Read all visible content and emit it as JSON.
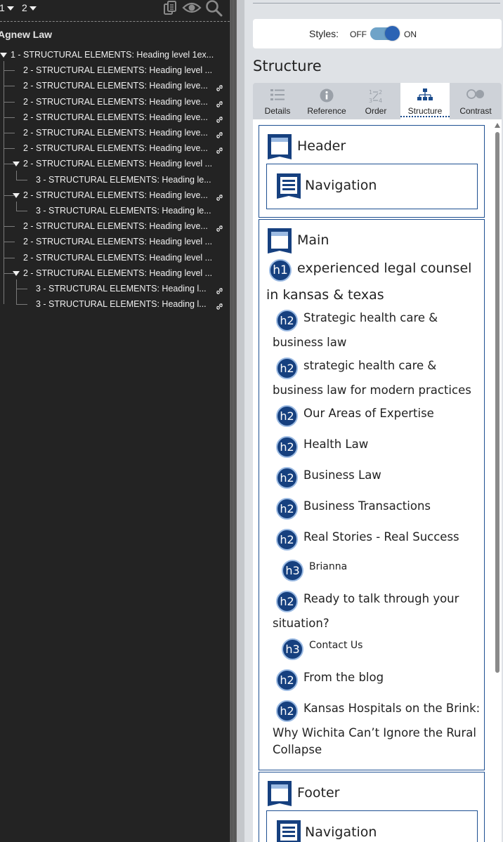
{
  "toolbar": {
    "level_from": "1",
    "level_to": "2"
  },
  "document": {
    "title": "Agnew Law"
  },
  "outline": [
    {
      "text": "1 - STRUCTURAL ELEMENTS: Heading level 1ex...",
      "level": 1,
      "has_link": false,
      "expanded": true
    },
    {
      "text": "2 - STRUCTURAL ELEMENTS: Heading level ...",
      "level": 2,
      "has_link": false
    },
    {
      "text": "2 - STRUCTURAL ELEMENTS: Heading leve...",
      "level": 2,
      "has_link": true
    },
    {
      "text": "2 - STRUCTURAL ELEMENTS: Heading leve...",
      "level": 2,
      "has_link": true
    },
    {
      "text": "2 - STRUCTURAL ELEMENTS: Heading leve...",
      "level": 2,
      "has_link": true
    },
    {
      "text": "2 - STRUCTURAL ELEMENTS: Heading leve...",
      "level": 2,
      "has_link": true
    },
    {
      "text": "2 - STRUCTURAL ELEMENTS: Heading leve...",
      "level": 2,
      "has_link": true
    },
    {
      "text": "2 - STRUCTURAL ELEMENTS: Heading level ...",
      "level": 2,
      "has_link": false,
      "expanded": true
    },
    {
      "text": "3 - STRUCTURAL ELEMENTS: Heading le...",
      "level": 3,
      "has_link": false
    },
    {
      "text": "2 - STRUCTURAL ELEMENTS: Heading leve...",
      "level": 2,
      "has_link": true,
      "expanded": true
    },
    {
      "text": "3 - STRUCTURAL ELEMENTS: Heading le...",
      "level": 3,
      "has_link": false
    },
    {
      "text": "2 - STRUCTURAL ELEMENTS: Heading leve...",
      "level": 2,
      "has_link": true
    },
    {
      "text": "2 - STRUCTURAL ELEMENTS: Heading level ...",
      "level": 2,
      "has_link": false
    },
    {
      "text": "2 - STRUCTURAL ELEMENTS: Heading level ...",
      "level": 2,
      "has_link": false
    },
    {
      "text": "2 - STRUCTURAL ELEMENTS: Heading level ...",
      "level": 2,
      "has_link": false,
      "expanded": true
    },
    {
      "text": "3 - STRUCTURAL ELEMENTS: Heading l...",
      "level": 3,
      "has_link": true
    },
    {
      "text": "3 - STRUCTURAL ELEMENTS: Heading l...",
      "level": 3,
      "has_link": true
    }
  ],
  "wave": {
    "styles_label": "Styles:",
    "styles_off": "OFF",
    "styles_on": "ON",
    "section_title": "Structure",
    "tabs": [
      {
        "label": "Details",
        "icon": "list-icon"
      },
      {
        "label": "Reference",
        "icon": "info-icon"
      },
      {
        "label": "Order",
        "icon": "order-icon"
      },
      {
        "label": "Structure",
        "icon": "structure-icon",
        "active": true
      },
      {
        "label": "Contrast",
        "icon": "contrast-icon"
      }
    ],
    "regions": {
      "header": "Header",
      "header_nav": "Navigation",
      "main": "Main",
      "footer": "Footer",
      "footer_nav": "Navigation"
    },
    "headings": [
      {
        "level": "h1",
        "line1": "experienced legal counsel",
        "line2": "in kansas & texas"
      },
      {
        "level": "h2",
        "line1": "Strategic health care &",
        "line2": "business law"
      },
      {
        "level": "h2",
        "line1": "strategic health care &",
        "line2": "business law for modern practices"
      },
      {
        "level": "h2",
        "line1": "Our Areas of Expertise"
      },
      {
        "level": "h2",
        "line1": "Health Law"
      },
      {
        "level": "h2",
        "line1": "Business Law"
      },
      {
        "level": "h2",
        "line1": "Business Transactions"
      },
      {
        "level": "h2",
        "line1": "Real Stories - Real Success"
      },
      {
        "level": "h3",
        "line1": "Brianna"
      },
      {
        "level": "h2",
        "line1": "Ready to talk through your",
        "line2": "situation?"
      },
      {
        "level": "h3",
        "line1": "Contact Us"
      },
      {
        "level": "h2",
        "line1": "From the blog"
      },
      {
        "level": "h2",
        "line1": "Kansas Hospitals on the Brink:",
        "line2": "Why Wichita Can’t Ignore the Rural",
        "line3": "Collapse"
      }
    ]
  },
  "colors": {
    "accent": "#16407f",
    "region_border": "#1d4f91",
    "toggle_knob": "#2b63b4"
  }
}
